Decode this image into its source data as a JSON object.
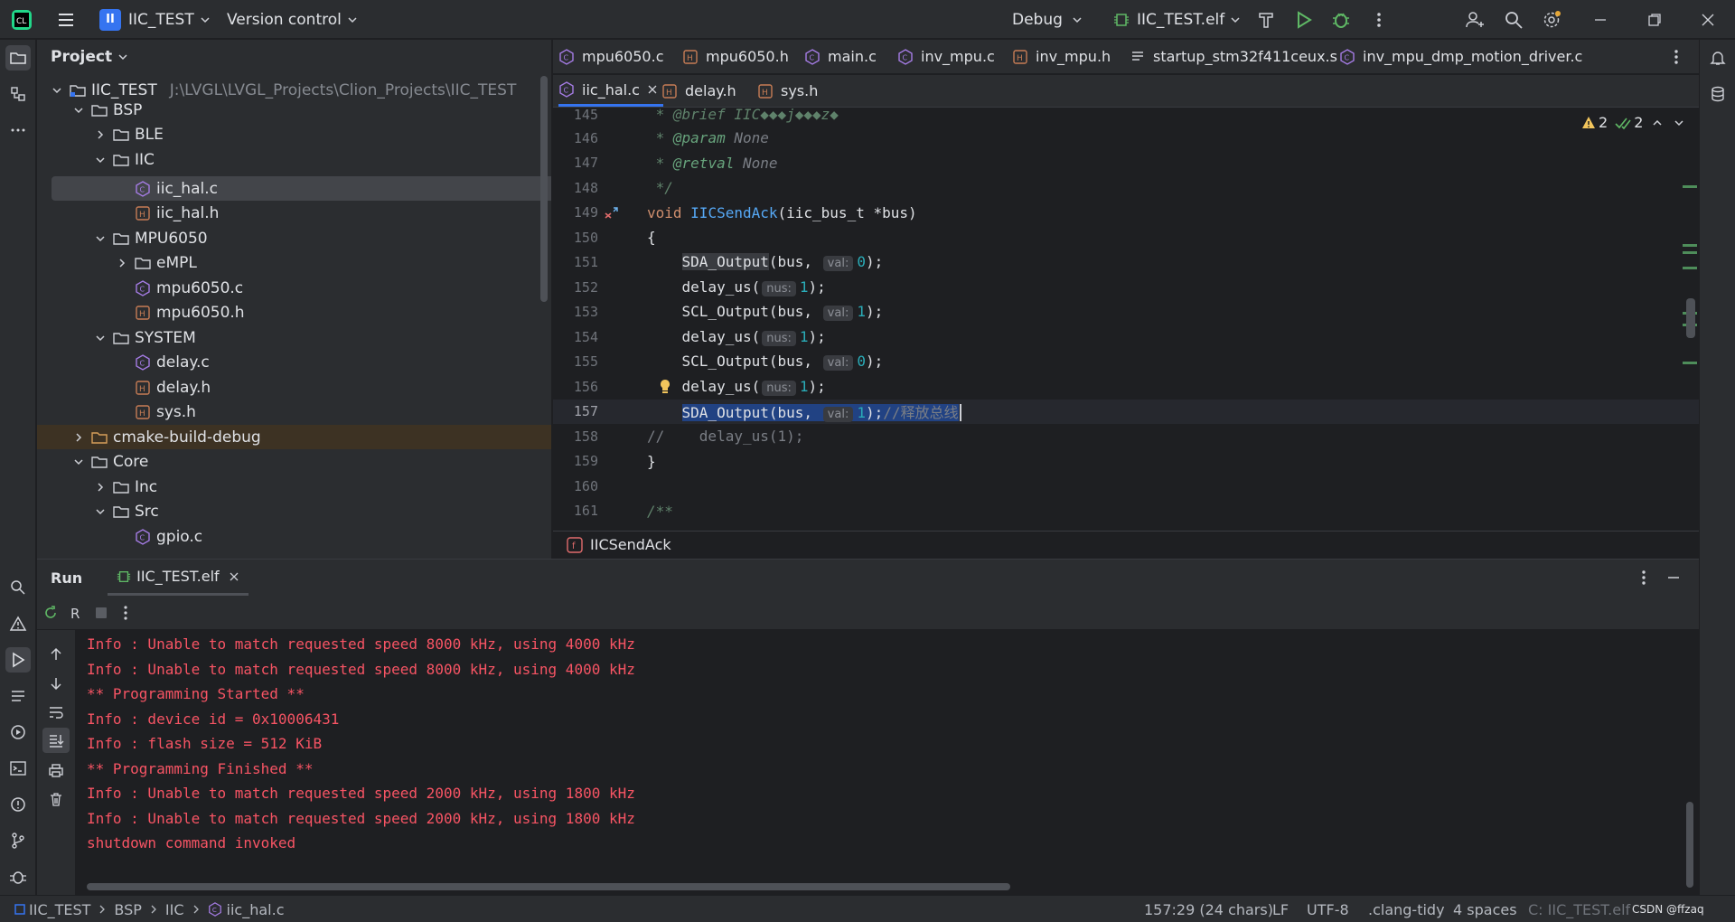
{
  "titlebar": {
    "project_badge": "II",
    "project_name": "IIC_TEST",
    "vcs": "Version control",
    "run_config": "Debug",
    "target": "IIC_TEST.elf"
  },
  "project_panel": {
    "title": "Project",
    "tree": [
      {
        "label": "IIC_TEST",
        "path": "J:\\LVGL\\LVGL_Projects\\Clion_Projects\\IIC_TEST"
      },
      {
        "label": "BSP"
      },
      {
        "label": "BLE"
      },
      {
        "label": "IIC"
      },
      {
        "label": "iic_hal.c"
      },
      {
        "label": "iic_hal.h"
      },
      {
        "label": "MPU6050"
      },
      {
        "label": "eMPL"
      },
      {
        "label": "mpu6050.c"
      },
      {
        "label": "mpu6050.h"
      },
      {
        "label": "SYSTEM"
      },
      {
        "label": "delay.c"
      },
      {
        "label": "delay.h"
      },
      {
        "label": "sys.h"
      },
      {
        "label": "cmake-build-debug"
      },
      {
        "label": "Core"
      },
      {
        "label": "Inc"
      },
      {
        "label": "Src"
      },
      {
        "label": "gpio.c"
      }
    ]
  },
  "editor": {
    "tabs_row1": [
      "mpu6050.c",
      "mpu6050.h",
      "main.c",
      "inv_mpu.c",
      "inv_mpu.h",
      "startup_stm32f411ceux.s",
      "inv_mpu_dmp_motion_driver.c"
    ],
    "tabs_row2": [
      "iic_hal.c",
      "delay.h",
      "sys.h"
    ],
    "inspections": {
      "warnings": "2",
      "ok": "2"
    },
    "line_numbers": [
      "145",
      "146",
      "147",
      "148",
      "149",
      "150",
      "151",
      "152",
      "153",
      "154",
      "155",
      "156",
      "157",
      "158",
      "159",
      "160",
      "161"
    ],
    "code": {
      "l145": " * @brief IIC\u0000\u0000\u0000j\u0000\u0000\u0000z\u0000",
      "l145_display": " * @brief IIC◆◆◆j◆◆◆z◆",
      "l146_tag": "@param",
      "l146_val": "None",
      "l147_tag": "@retval",
      "l147_val": "None",
      "l148": " */",
      "l149_kw": "void",
      "l149_fn": "IICSendAck",
      "l149_rest": "(iic_bus_t *bus)",
      "l150": "{",
      "sda": "SDA_Output",
      "scl": "SCL_Output",
      "delay": "delay_us",
      "bus_arg": "(bus,",
      "paren": "(",
      "hint_val": "val:",
      "hint_nus": "nus:",
      "v0": "0",
      "v1": "1",
      "close": ");",
      "l157_comment": "//释放总线",
      "l158": "//    delay_us(1);",
      "l159": "}",
      "l161": "/**"
    },
    "breadcrumb": "IICSendAck"
  },
  "run_panel": {
    "tab_run": "Run",
    "tab_target": "IIC_TEST.elf",
    "console": [
      "Info : Unable to match requested speed 8000 kHz, using 4000 kHz",
      "Info : Unable to match requested speed 8000 kHz, using 4000 kHz",
      "** Programming Started **",
      "Info : device id = 0x10006431",
      "Info : flash size = 512 KiB",
      "** Programming Finished **",
      "Info : Unable to match requested speed 2000 kHz, using 1800 kHz",
      "Info : Unable to match requested speed 2000 kHz, using 1800 kHz",
      "shutdown command invoked"
    ]
  },
  "statusbar": {
    "crumbs": [
      "IIC_TEST",
      "BSP",
      "IIC",
      "iic_hal.c"
    ],
    "position": "157:29 (24 chars)",
    "line_sep": "LF",
    "encoding": "UTF-8",
    "linter": ".clang-tidy",
    "indent": "4 spaces",
    "context": "C: IIC_TEST.elf",
    "watermark": "CSDN @ffzaq"
  },
  "colors": {
    "accent": "#3574f0",
    "console_text": "#f75464",
    "background": "#1e1f22",
    "panel": "#2b2d30"
  }
}
